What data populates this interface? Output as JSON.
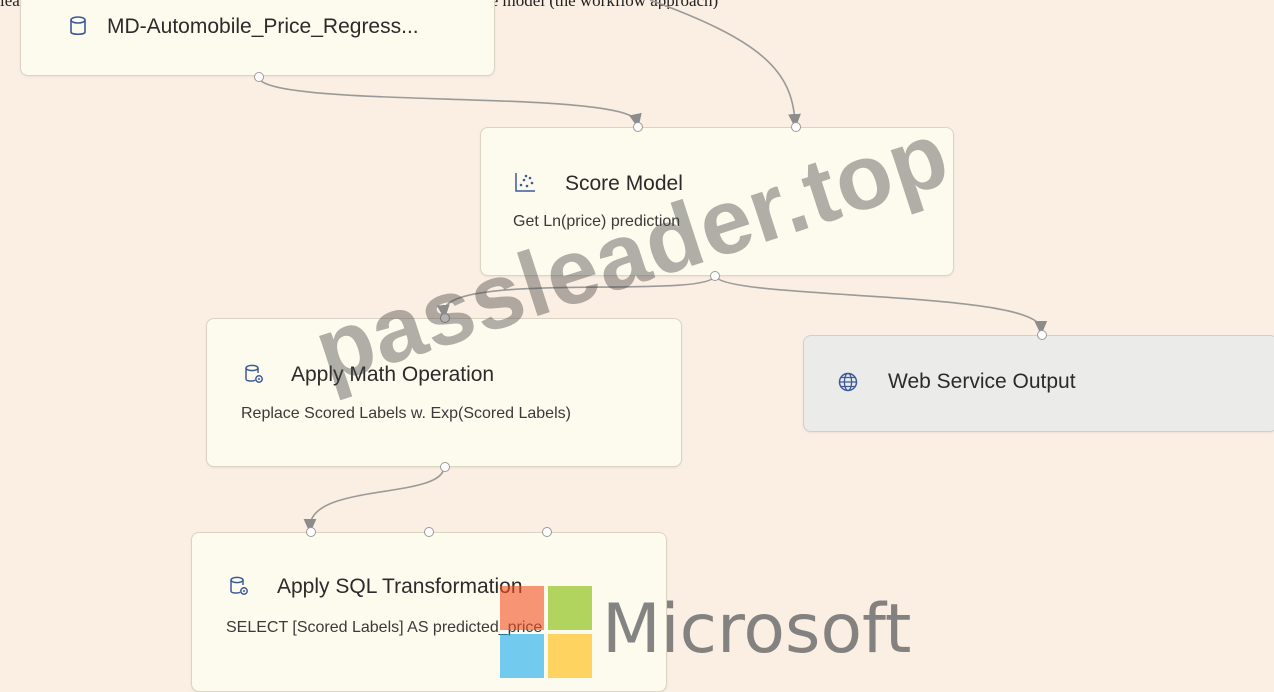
{
  "caption": "leave each of the Web service port in the flowing pattern, as shown in the model (the workflow approach)",
  "nodes": {
    "dataset": {
      "title": "MD-Automobile_Price_Regress..."
    },
    "score_model": {
      "title": "Score Model",
      "subtitle": "Get Ln(price) prediction"
    },
    "apply_math": {
      "title": "Apply Math Operation",
      "subtitle": "Replace Scored Labels w. Exp(Scored Labels)"
    },
    "web_output": {
      "title": "Web Service Output"
    },
    "apply_sql": {
      "title": "Apply SQL Transformation",
      "subtitle": "SELECT [Scored Labels] AS predicted_price"
    }
  },
  "watermark": "passleader.top",
  "logo": {
    "text": "Microsoft",
    "colors": [
      "#f25022",
      "#7fba00",
      "#00a4ef",
      "#ffb900"
    ]
  },
  "icons": {
    "dataset": "database-icon",
    "score_model": "scatter-plot-icon",
    "apply_math": "module-gear-icon",
    "web_output": "globe-icon",
    "apply_sql": "module-gear-icon"
  }
}
